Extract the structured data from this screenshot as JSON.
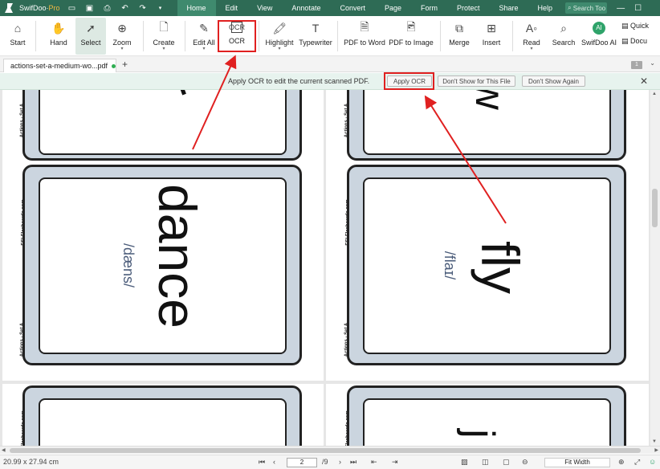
{
  "app": {
    "name": "SwifDoo",
    "edition": "Pro"
  },
  "menu": [
    "Home",
    "Edit",
    "View",
    "Annotate",
    "Convert",
    "Page",
    "Form",
    "Protect",
    "Share",
    "Help"
  ],
  "menu_active": "Home",
  "search_placeholder": "Search Too",
  "ribbon": {
    "start": "Start",
    "hand": "Hand",
    "select": "Select",
    "zoom": "Zoom",
    "create": "Create",
    "edit_all": "Edit All",
    "ocr": "OCR",
    "highlight": "Highlight",
    "typewriter": "Typewriter",
    "pdf_to_word": "PDF to Word",
    "pdf_to_image": "PDF to Image",
    "merge": "Merge",
    "insert": "Insert",
    "read": "Read",
    "search": "Search",
    "swifdoo_ai": "SwifDoo AI",
    "quick": "Quick",
    "docu": "Docu",
    "ai_badge": "AI"
  },
  "tab": {
    "filename": "actions-set-a-medium-wo...pdf",
    "page_badge": "1"
  },
  "ocr_bar": {
    "message": "Apply OCR to edit the current scanned PDF.",
    "apply": "Apply OCR",
    "dont_show_file": "Don't Show for This File",
    "dont_show_again": "Don't Show Again"
  },
  "cards": {
    "side_top": "Actions - Set A",
    "side_bottom": "ESLFlashcards.com",
    "word_left": "dance",
    "phon_left": "/dæns/",
    "word_right": "fly",
    "phon_right": "/flaɪ/",
    "glyph_top_right": "w",
    "glyph_bottom_right": "j"
  },
  "status": {
    "page_size": "20.99 x 27.94 cm",
    "current_page": "2",
    "total_pages": "/9",
    "zoom_mode": "Fit Width"
  },
  "colors": {
    "brand": "#2e6b55",
    "highlight_box": "#e02020"
  }
}
